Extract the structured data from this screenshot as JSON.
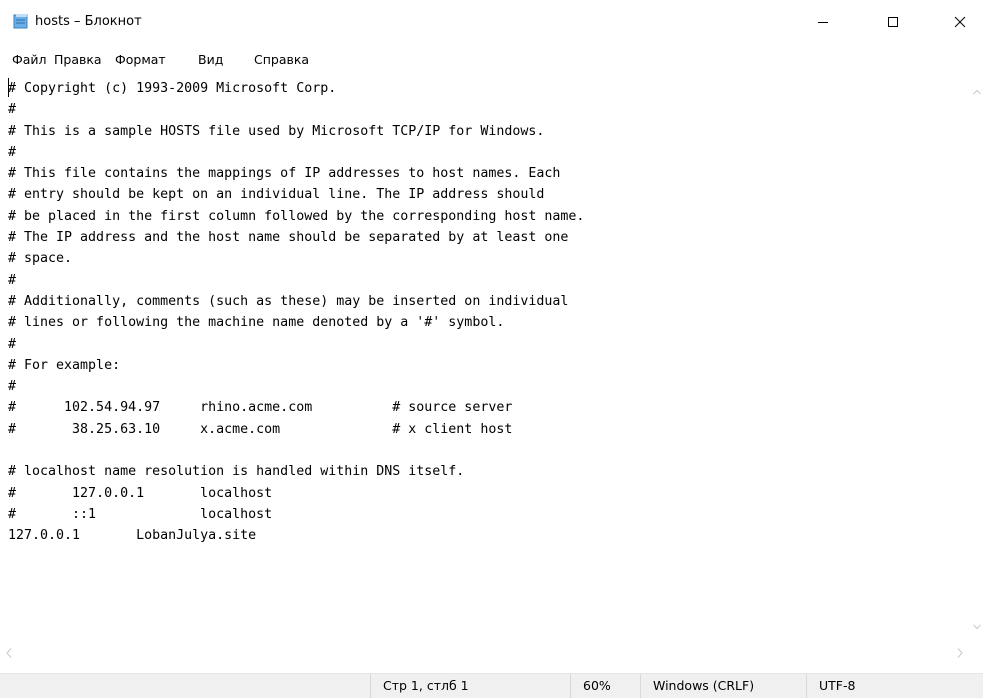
{
  "window": {
    "title": "hosts – Блокнот",
    "icon": "notepad-icon",
    "controls": {
      "minimize": "minimize-icon",
      "maximize": "maximize-icon",
      "close": "close-icon"
    }
  },
  "menu": {
    "items": [
      "Файл",
      "Правка",
      "Формат",
      "Вид",
      "Справка"
    ]
  },
  "editor": {
    "lines": [
      "# Copyright (c) 1993-2009 Microsoft Corp.",
      "#",
      "# This is a sample HOSTS file used by Microsoft TCP/IP for Windows.",
      "#",
      "# This file contains the mappings of IP addresses to host names. Each",
      "# entry should be kept on an individual line. The IP address should",
      "# be placed in the first column followed by the corresponding host name.",
      "# The IP address and the host name should be separated by at least one",
      "# space.",
      "#",
      "# Additionally, comments (such as these) may be inserted on individual",
      "# lines or following the machine name denoted by a '#' symbol.",
      "#",
      "# For example:",
      "#",
      "#      102.54.94.97     rhino.acme.com          # source server",
      "#       38.25.63.10     x.acme.com              # x client host",
      "",
      "# localhost name resolution is handled within DNS itself.",
      "#\t127.0.0.1       localhost",
      "#\t::1             localhost",
      "127.0.0.1       LobanJulya.site"
    ]
  },
  "status": {
    "position": "Стр 1, стлб 1",
    "zoom": "60%",
    "line_endings": "Windows (CRLF)",
    "encoding": "UTF-8"
  }
}
